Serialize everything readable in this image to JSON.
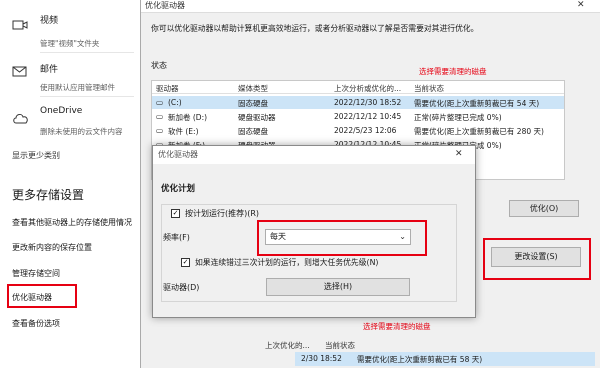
{
  "left_panel": {
    "items": [
      {
        "title": "视频",
        "desc": "管理\"视频\"文件夹",
        "icon": "video-icon"
      },
      {
        "title": "邮件",
        "desc": "使用默认应用管理邮件",
        "icon": "mail-icon"
      },
      {
        "title": "OneDrive",
        "desc": "删除未使用的云文件内容",
        "icon": "cloud-icon"
      }
    ],
    "show_fewer": "显示更少类别",
    "more_title": "更多存储设置",
    "links": [
      "查看其他驱动器上的存储使用情况",
      "更改新内容的保存位置",
      "管理存储空间",
      "优化驱动器",
      "查看备份选项"
    ]
  },
  "main_window": {
    "title": "优化驱动器",
    "description": "你可以优化驱动器以帮助计算机更高效地运行，或者分析驱动器以了解是否需要对其进行优化。",
    "status_label": "状态",
    "note_top": "选择需要清理的磁盘",
    "note_bottom": "选择需要清理的磁盘",
    "columns": [
      "驱动器",
      "媒体类型",
      "上次分析或优化的...",
      "当前状态"
    ],
    "rows": [
      {
        "drive": "(C:)",
        "media": "固态硬盘",
        "last": "2022/12/30 18:52",
        "status": "需要优化(距上次重新剪裁已有 54 天)"
      },
      {
        "drive": "新加卷 (D:)",
        "media": "硬盘驱动器",
        "last": "2022/12/12 10:45",
        "status": "正常(碎片整理已完成 0%)"
      },
      {
        "drive": "软件 (E:)",
        "media": "固态硬盘",
        "last": "2022/5/23 12:06",
        "status": "需要优化(距上次重新剪裁已有 280 天)"
      },
      {
        "drive": "新加卷 (F:)",
        "media": "硬盘驱动器",
        "last": "2022/12/12 10:45",
        "status": "正常(碎片整理已完成 0%)"
      }
    ],
    "optimize_button": "优化(O)",
    "change_settings_button": "更改设置(S)",
    "bottom_row": {
      "last": "2/30 18:52",
      "status": "需要优化(距上次重新剪裁已有 58 天)"
    },
    "bottom_label_1": "当前状态",
    "bottom_label_2": "上次优化的..."
  },
  "dialog": {
    "title": "优化驱动器",
    "section": "优化计划",
    "run_schedule": "按计划运行(推荐)(R)",
    "frequency_label": "频率(F)",
    "frequency_value": "每天",
    "priority_text": "如果连续错过三次计划的运行，则增大任务优先级(N)",
    "drives_label": "驱动器(D)",
    "choose_button": "选择(H)",
    "run_schedule_checked": true,
    "priority_checked": true
  },
  "colors": {
    "highlight_red": "#e60012",
    "selected_row": "#cce4f7"
  }
}
